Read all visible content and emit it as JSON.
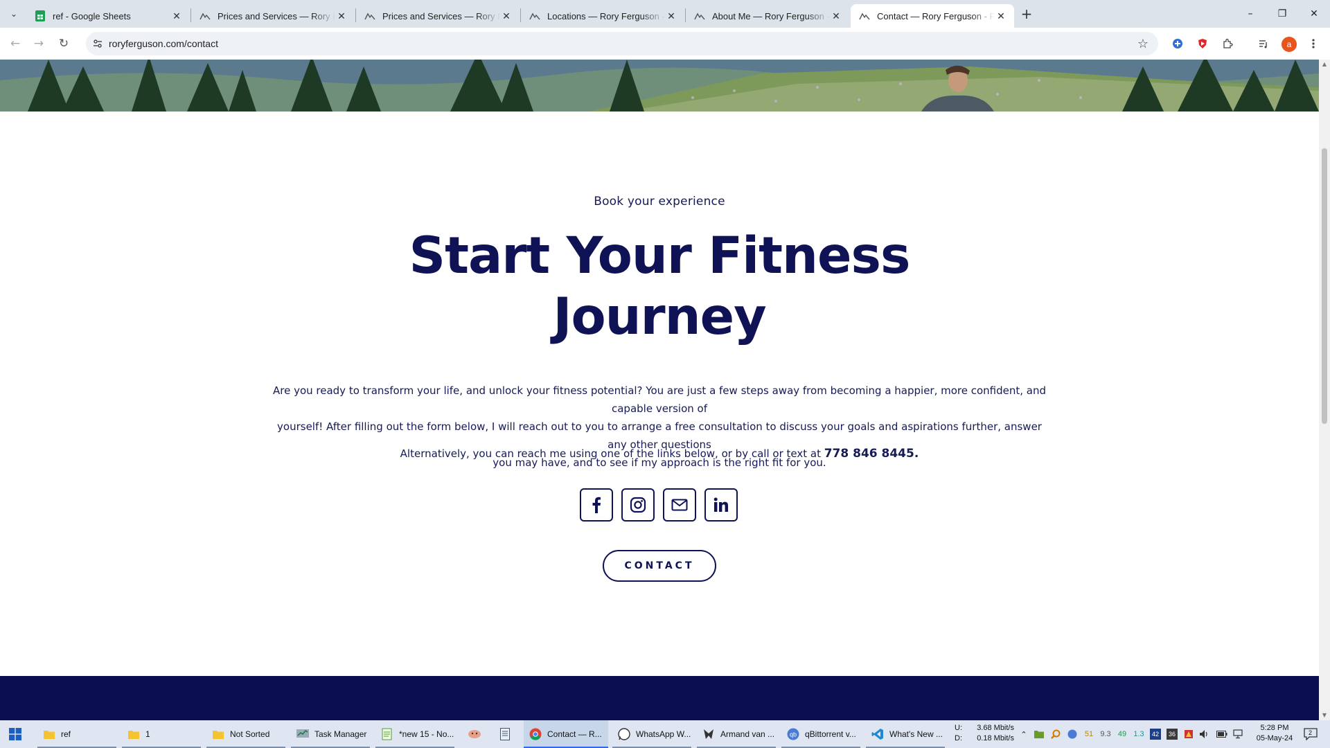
{
  "browser": {
    "tabs": [
      {
        "title": "ref - Google Sheets",
        "favicon": "google-sheets-icon",
        "active": false
      },
      {
        "title": "Prices and Services — Rory Ferguson",
        "favicon": "squarespace-icon",
        "active": false
      },
      {
        "title": "Prices and Services — Rory Ferguson",
        "favicon": "squarespace-icon",
        "active": false
      },
      {
        "title": "Locations — Rory Ferguson - Personal",
        "favicon": "squarespace-icon",
        "active": false
      },
      {
        "title": "About Me — Rory Ferguson - Personal",
        "favicon": "squarespace-icon",
        "active": false
      },
      {
        "title": "Contact — Rory Ferguson - Personal",
        "favicon": "squarespace-icon",
        "active": true
      }
    ],
    "url": "roryferguson.com/contact",
    "profile_initial": "a"
  },
  "page": {
    "eyebrow": "Book your experience",
    "headline_line1": "Start Your Fitness",
    "headline_line2": "Journey",
    "intro_line1": "Are you ready to transform your life, and unlock your fitness potential?  You are just a few steps away from becoming a happier, more confident, and capable version of",
    "intro_line2": "yourself! After filling out the form below, I will reach out to you to arrange a free consultation to discuss your goals and aspirations further, answer any other questions",
    "intro_line3": "you may have, and to see if my approach is the right fit for you.",
    "alt_text": "Alternatively, you can reach me using one of the links below, or by call or text at ",
    "phone": "778 846 8445.",
    "social_links": [
      "facebook-icon",
      "instagram-icon",
      "email-icon",
      "linkedin-icon"
    ],
    "contact_button": "CONTACT",
    "colors": {
      "navy": "#0f1356",
      "footer": "#0a0f52"
    }
  },
  "taskbar": {
    "items": [
      {
        "label": "ref",
        "icon": "folder-icon"
      },
      {
        "label": "1",
        "icon": "folder-icon"
      },
      {
        "label": "Not Sorted",
        "icon": "folder-icon"
      },
      {
        "label": "Task Manager",
        "icon": "task-manager-icon"
      },
      {
        "label": "*new 15 - No...",
        "icon": "notepad-plus-icon"
      },
      {
        "label": "",
        "icon": "app-icon"
      },
      {
        "label": "",
        "icon": "document-icon"
      },
      {
        "label": "Contact — R...",
        "icon": "chrome-icon"
      },
      {
        "label": "WhatsApp W...",
        "icon": "whatsapp-icon"
      },
      {
        "label": "Armand van ...",
        "icon": "media-icon"
      },
      {
        "label": "qBittorrent v...",
        "icon": "qbittorrent-icon"
      },
      {
        "label": "What's New ...",
        "icon": "vscode-icon"
      }
    ],
    "net_up_label": "U:",
    "net_down_label": "D:",
    "net_up": "3.68 Mbit/s",
    "net_down": "0.18 Mbit/s",
    "tray_nums": [
      "51",
      "9.3",
      "49",
      "1.3",
      "42",
      "36"
    ],
    "time": "5:28 PM",
    "date": "05-May-24",
    "notifications": "2"
  }
}
